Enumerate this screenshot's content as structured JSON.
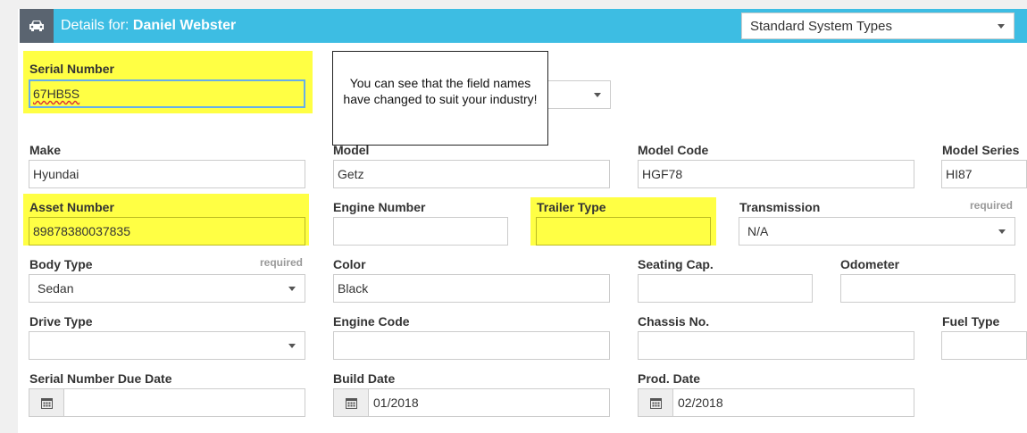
{
  "header": {
    "title_prefix": "Details for:",
    "title_name": "Daniel Webster",
    "icon": "car-icon",
    "system_select": "Standard System Types"
  },
  "callout": {
    "text": "You can see that the field names have changed to suit your industry!"
  },
  "fields": {
    "serial_number": {
      "label": "Serial Number",
      "value": "67HB5S"
    },
    "make": {
      "label": "Make",
      "value": "Hyundai"
    },
    "model": {
      "label": "Model",
      "value": "Getz"
    },
    "model_code": {
      "label": "Model Code",
      "value": "HGF78"
    },
    "model_series": {
      "label": "Model Series",
      "value": "HI87"
    },
    "asset_number": {
      "label": "Asset Number",
      "value": "89878380037835"
    },
    "engine_number": {
      "label": "Engine Number",
      "value": ""
    },
    "trailer_type": {
      "label": "Trailer Type",
      "value": ""
    },
    "transmission": {
      "label": "Transmission",
      "required": "required",
      "value": "N/A"
    },
    "body_type": {
      "label": "Body Type",
      "required": "required",
      "value": "Sedan"
    },
    "color": {
      "label": "Color",
      "value": "Black"
    },
    "seating_cap": {
      "label": "Seating Cap.",
      "value": ""
    },
    "odometer": {
      "label": "Odometer",
      "value": ""
    },
    "drive_type": {
      "label": "Drive Type",
      "value": ""
    },
    "engine_code": {
      "label": "Engine Code",
      "value": ""
    },
    "chassis_no": {
      "label": "Chassis No.",
      "value": ""
    },
    "fuel_type": {
      "label": "Fuel Type",
      "value": ""
    },
    "serial_number_due_date": {
      "label": "Serial Number Due Date",
      "value": ""
    },
    "build_date": {
      "label": "Build Date",
      "value": "01/2018"
    },
    "prod_date": {
      "label": "Prod. Date",
      "value": "02/2018"
    }
  },
  "colors": {
    "header": "#3dbde3",
    "icon_box": "#5a6470",
    "highlight": "#ffff44"
  }
}
